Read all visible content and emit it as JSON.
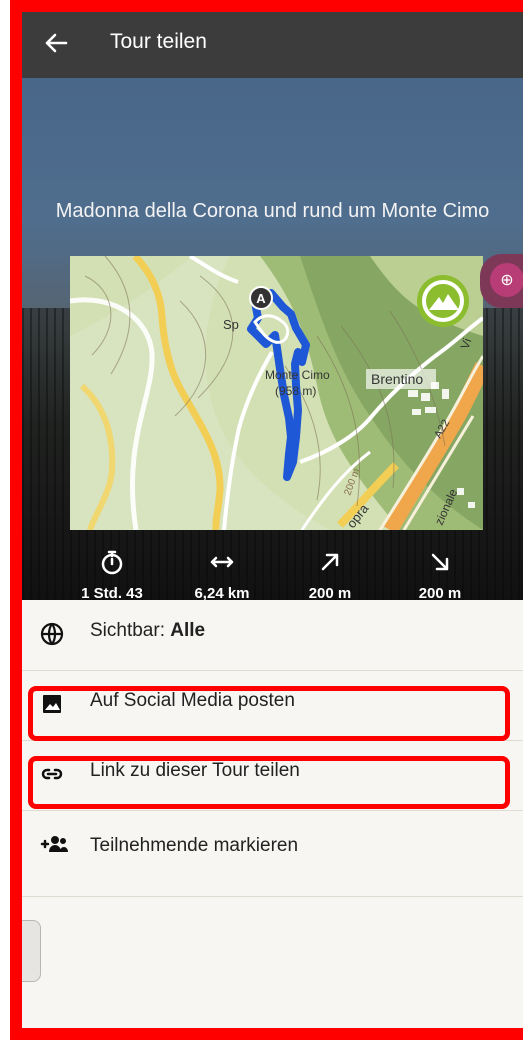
{
  "app_bar": {
    "title": "Tour teilen",
    "back_icon": "arrow-left-icon"
  },
  "tour": {
    "title": "Madonna della Corona und rund um Monte Cimo"
  },
  "map": {
    "labels": [
      "A",
      "Sp",
      "Monte Cimo",
      "(958 m)",
      "Brentino",
      "A22",
      "Vi",
      "200 m",
      "opra",
      "zionale"
    ]
  },
  "zoom": {
    "icon": "zoom-in-icon"
  },
  "stats": [
    {
      "icon": "stopwatch-icon",
      "value": "1 Std. 43"
    },
    {
      "icon": "distance-icon",
      "value": "6,24 km"
    },
    {
      "icon": "ascent-icon",
      "value": "200 m"
    },
    {
      "icon": "descent-icon",
      "value": "200 m"
    }
  ],
  "visibility": {
    "label": "Sichtbar:",
    "value": "Alle",
    "icon": "globe-icon"
  },
  "actions": [
    {
      "label": "Auf Social Media posten",
      "icon": "image-icon"
    },
    {
      "label": "Link zu dieser Tour teilen",
      "icon": "link-icon"
    },
    {
      "label": "Teilnehmende markieren",
      "icon": "add-people-icon"
    }
  ],
  "colors": {
    "accent": "#ff0000",
    "route": "#1f58d6",
    "zoom": "#b83d76",
    "app_bar": "#3c3c3c"
  }
}
